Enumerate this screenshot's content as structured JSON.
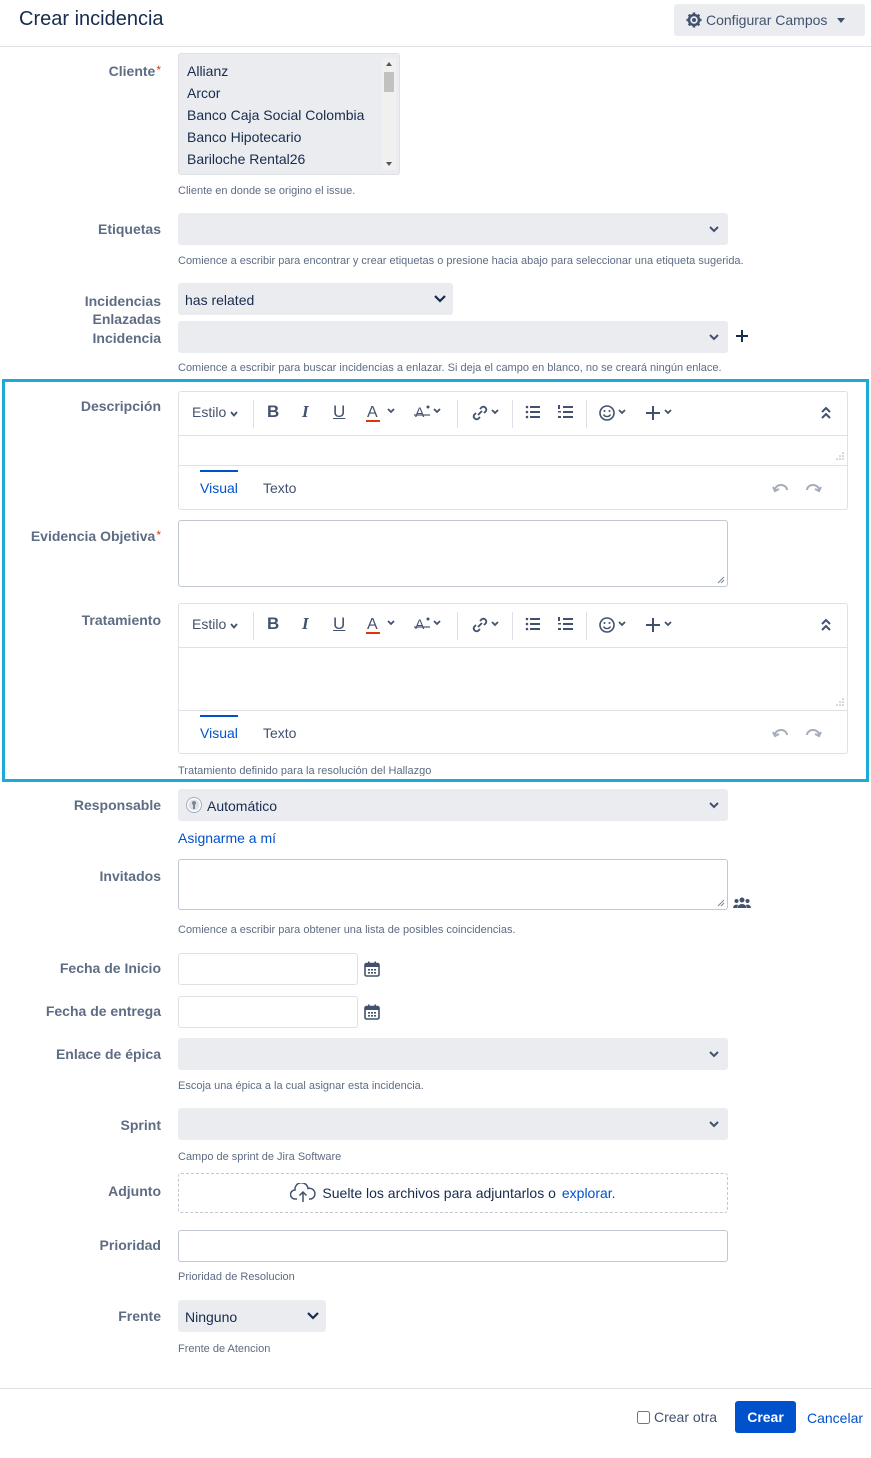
{
  "header": {
    "title": "Crear incidencia",
    "config_label": "Configurar Campos"
  },
  "cliente": {
    "label": "Cliente",
    "required": "*",
    "options": [
      "Allianz",
      "Arcor",
      "Banco Caja Social Colombia",
      "Banco Hipotecario",
      "Bariloche Rental26"
    ],
    "help": "Cliente en donde se origino el issue."
  },
  "etiquetas": {
    "label": "Etiquetas",
    "help": "Comience a escribir para encontrar y crear etiquetas o presione hacia abajo para seleccionar una etiqueta sugerida."
  },
  "incidencias": {
    "label_line1": "Incidencias",
    "label_line2": "Enlazadas",
    "label2": "Incidencia",
    "relation": "has related",
    "help": "Comience a escribir para buscar incidencias a enlazar. Si deja el campo en blanco, no se creará ningún enlace."
  },
  "editor_common": {
    "style": "Estilo",
    "tab_visual": "Visual",
    "tab_text": "Texto"
  },
  "descripcion": {
    "label": "Descripción"
  },
  "evidencia": {
    "label": "Evidencia Objetiva",
    "required": "*"
  },
  "tratamiento": {
    "label": "Tratamiento",
    "help": "Tratamiento definido para la resolución del Hallazgo"
  },
  "responsable": {
    "label": "Responsable",
    "value": "Automático",
    "assign_me": "Asignarme a mí"
  },
  "invitados": {
    "label": "Invitados",
    "help": "Comience a escribir para obtener una lista de posibles coincidencias."
  },
  "fecha_inicio": {
    "label": "Fecha de Inicio"
  },
  "fecha_entrega": {
    "label": "Fecha de entrega"
  },
  "epica": {
    "label": "Enlace de épica",
    "help": "Escoja una épica a la cual asignar esta incidencia."
  },
  "sprint": {
    "label": "Sprint",
    "help": "Campo de sprint de Jira Software"
  },
  "adjunto": {
    "label": "Adjunto",
    "drop_text": "Suelte los archivos para adjuntarlos o",
    "browse": "explorar."
  },
  "prioridad": {
    "label": "Prioridad",
    "help": "Prioridad de Resolucion"
  },
  "frente": {
    "label": "Frente",
    "value": "Ninguno",
    "help": "Frente de Atencion"
  },
  "footer": {
    "create_another": "Crear otra",
    "create": "Crear",
    "cancel": "Cancelar"
  },
  "colors": {
    "accent": "#0052cc",
    "highlight": "#1eaad9",
    "required": "#de350b"
  }
}
